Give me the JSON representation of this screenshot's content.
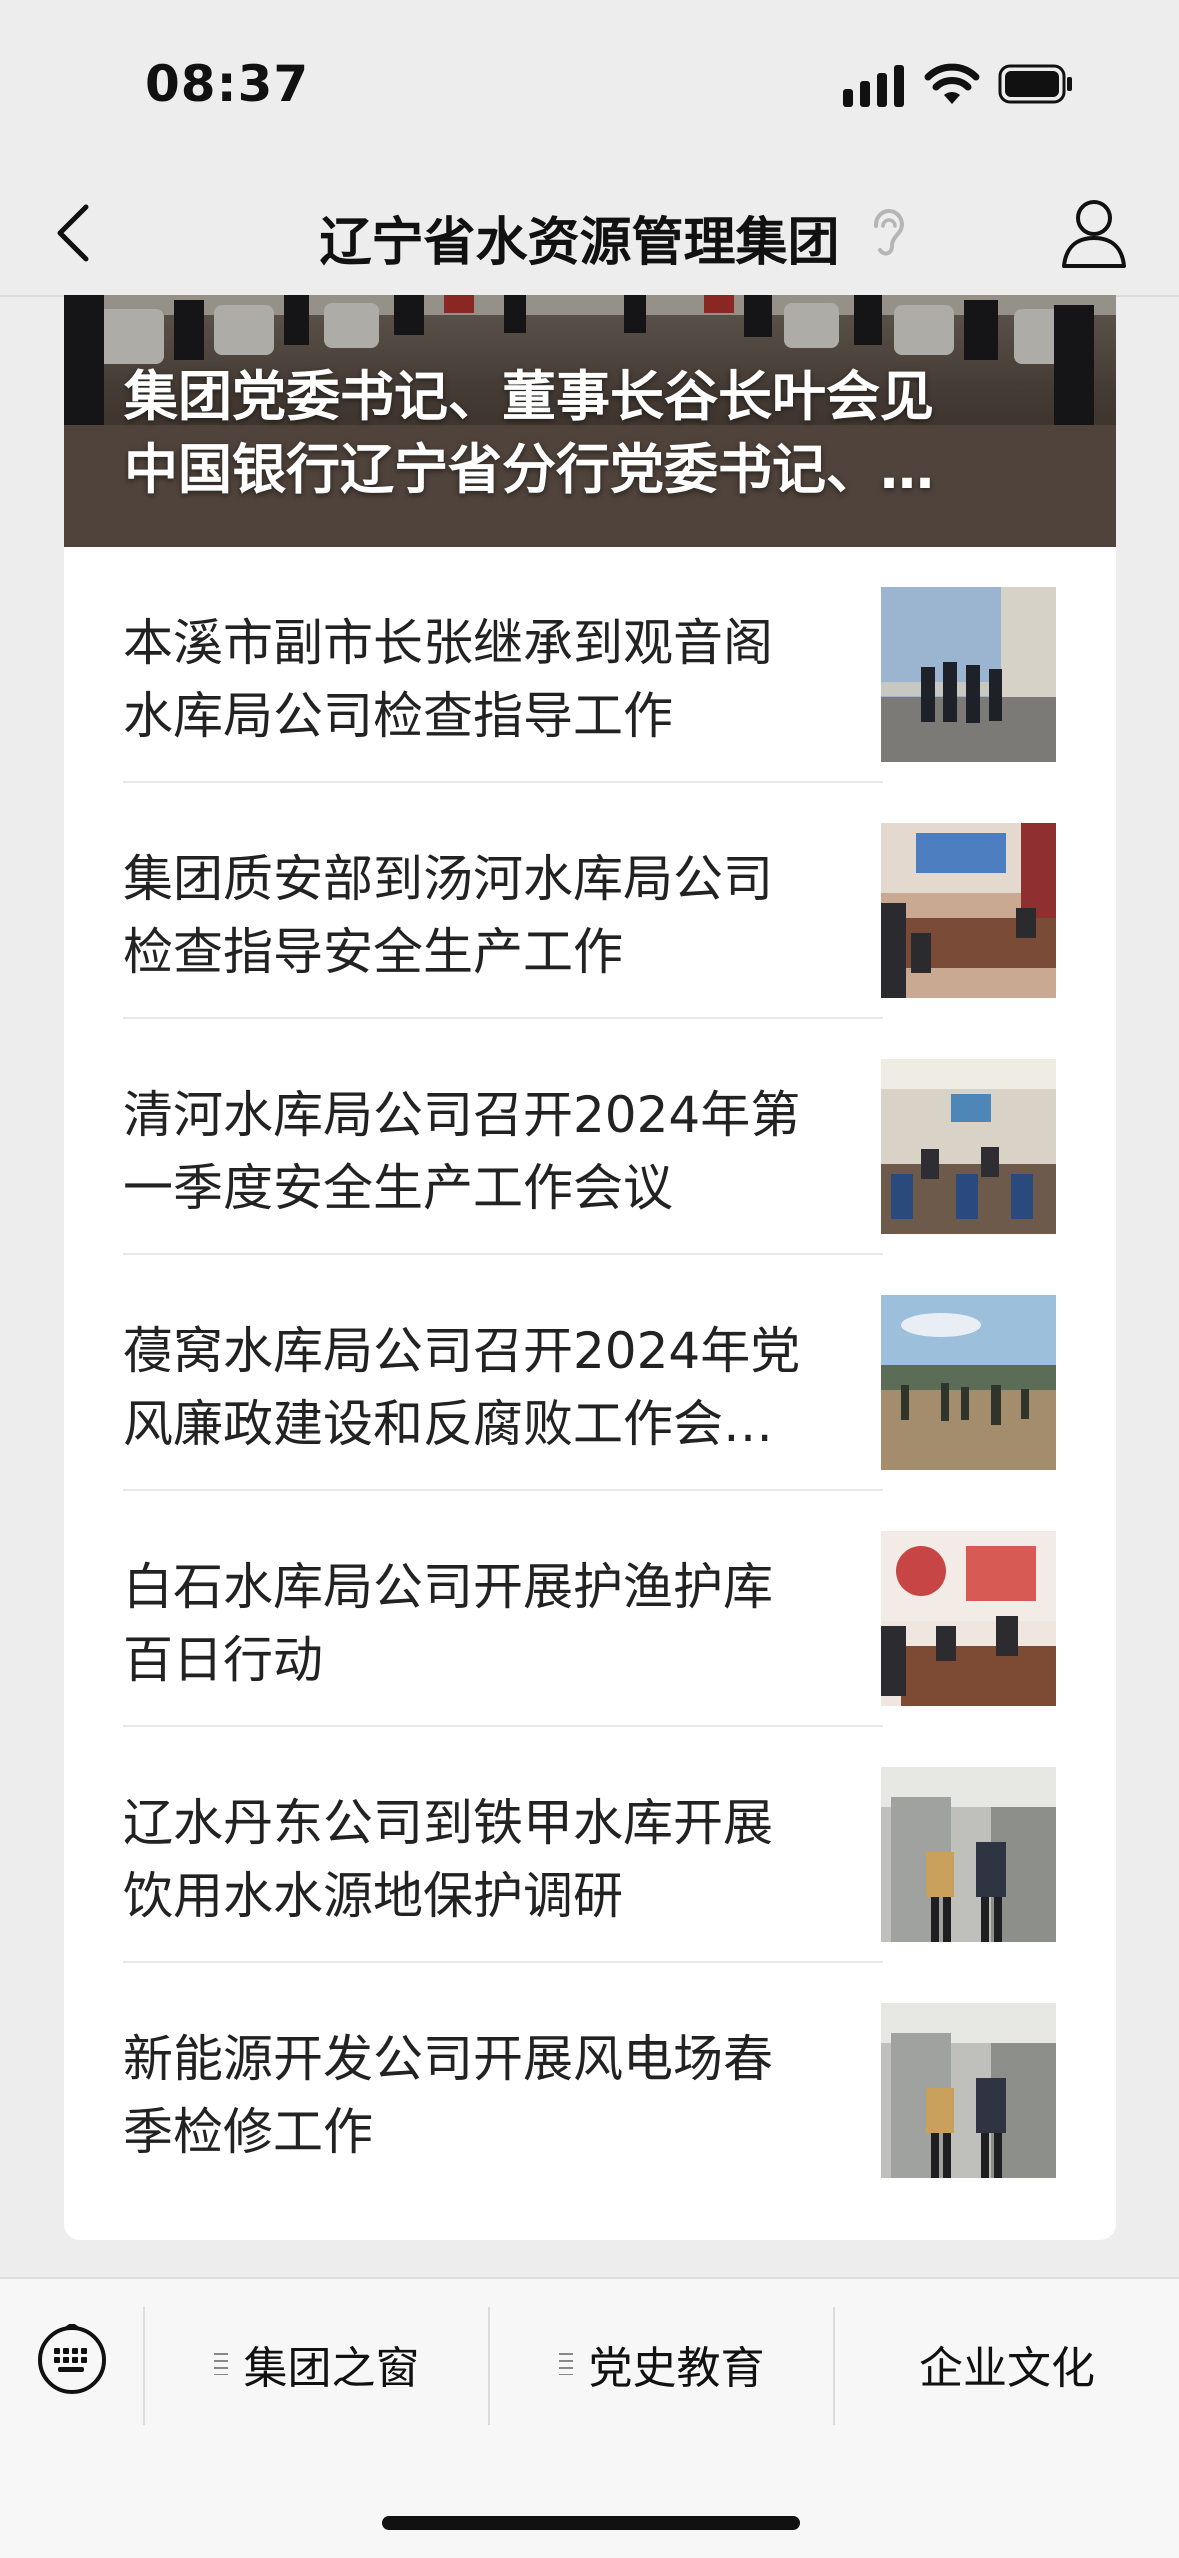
{
  "status_bar": {
    "time": "08:37"
  },
  "nav": {
    "title": "辽宁省水资源管理集团"
  },
  "hero": {
    "title_line1": "集团党委书记、董事长谷长叶会见",
    "title_line2": "中国银行辽宁省分行党委书记、…"
  },
  "articles": [
    {
      "line1": "本溪市副市长张继承到观音阁",
      "line2": "水库局公司检查指导工作"
    },
    {
      "line1": "集团质安部到汤河水库局公司",
      "line2": "检查指导安全生产工作"
    },
    {
      "line1": "清河水库局公司召开2024年第",
      "line2": "一季度安全生产工作会议"
    },
    {
      "line1": "葠窝水库局公司召开2024年党",
      "line2": "风廉政建设和反腐败工作会…"
    },
    {
      "line1": "白石水库局公司开展护渔护库",
      "line2": "百日行动"
    },
    {
      "line1": "辽水丹东公司到铁甲水库开展",
      "line2": "饮用水水源地保护调研"
    },
    {
      "line1": "新能源开发公司开展风电场春",
      "line2": "季检修工作"
    }
  ],
  "menu": {
    "item1": "集团之窗",
    "item2": "党史教育",
    "item3": "企业文化"
  },
  "icons": {
    "back": "chevron-left-icon",
    "profile": "person-icon",
    "ear": "ear-icon",
    "keyboard": "keyboard-icon"
  }
}
